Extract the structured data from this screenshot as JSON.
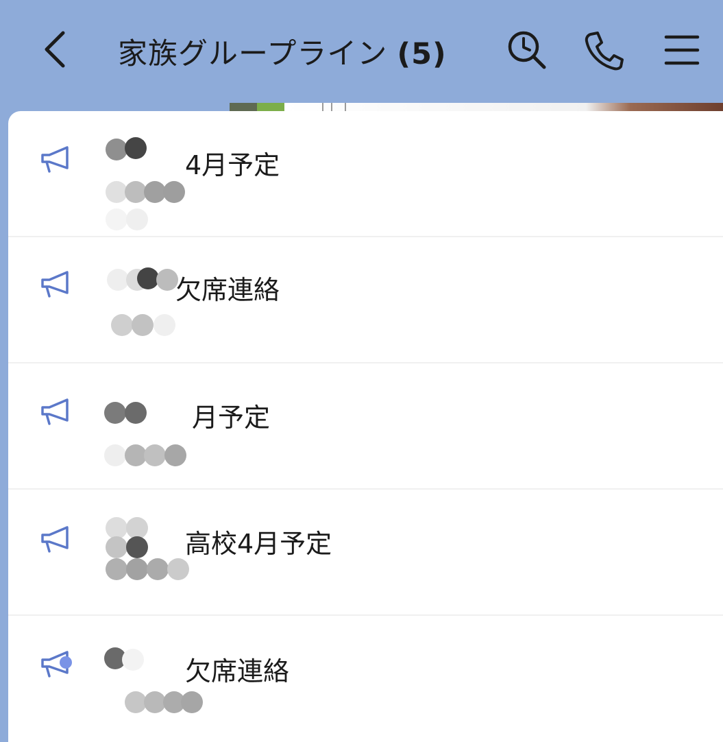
{
  "header": {
    "title": "家族グループライン",
    "member_count": "(5)",
    "icons": {
      "back": "chevron-left-icon",
      "search": "clock-search-icon",
      "call": "phone-icon",
      "menu": "hamburger-menu-icon"
    }
  },
  "colors": {
    "header_bg": "#8eabd9",
    "panel_bg": "#ffffff",
    "megaphone": "#5b78c9",
    "text": "#1b1b1b"
  },
  "announcements": [
    {
      "icon": "megaphone-icon",
      "text": "4月予定"
    },
    {
      "icon": "megaphone-icon",
      "text": "欠席連絡"
    },
    {
      "icon": "megaphone-icon",
      "text": "月予定"
    },
    {
      "icon": "megaphone-icon",
      "text": "高校4月予定"
    },
    {
      "icon": "megaphone-icon",
      "text": "欠席連絡"
    }
  ]
}
